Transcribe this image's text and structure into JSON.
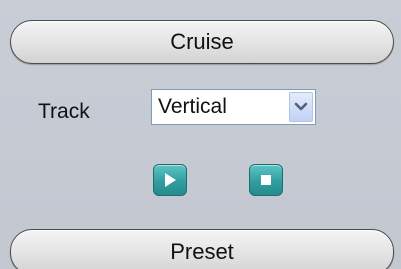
{
  "cruise": {
    "button_label": "Cruise"
  },
  "track": {
    "label": "Track",
    "selected": "Vertical",
    "arrow_icon": "chevron-down-icon"
  },
  "controls": {
    "play_icon": "play-icon",
    "stop_icon": "stop-icon",
    "accent_color": "#2f9ea1"
  },
  "preset": {
    "button_label": "Preset"
  }
}
